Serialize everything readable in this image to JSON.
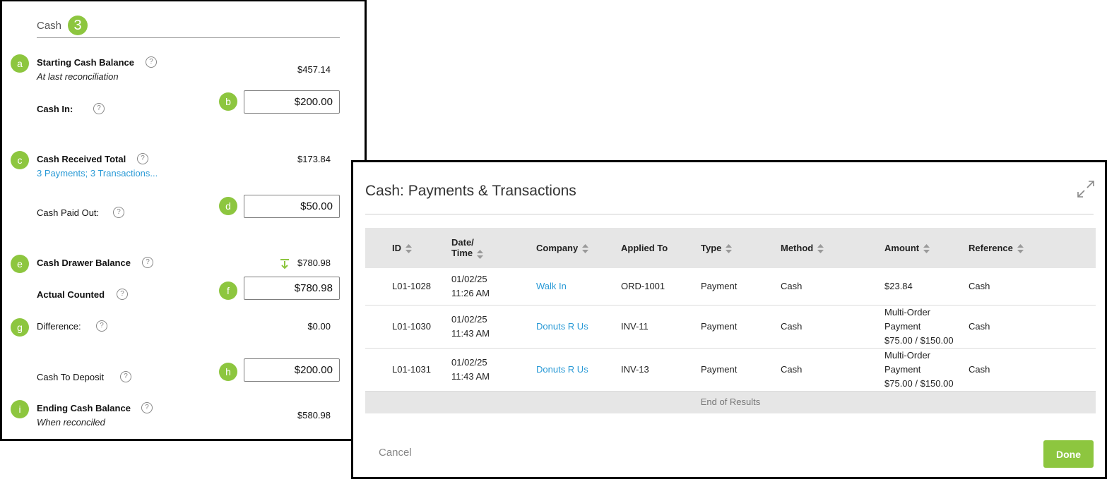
{
  "cash_panel": {
    "title": "Cash",
    "badge": "3",
    "starting": {
      "badge": "a",
      "label": "Starting Cash Balance",
      "sub": "At last reconciliation",
      "value": "$457.14"
    },
    "cash_in": {
      "label": "Cash In:",
      "badge": "b",
      "value": "$200.00"
    },
    "received": {
      "badge": "c",
      "label": "Cash Received Total",
      "link": "3 Payments; 3 Transactions...",
      "value": "$173.84"
    },
    "paid_out": {
      "label": "Cash Paid Out:",
      "badge": "d",
      "value": "$50.00"
    },
    "drawer": {
      "badge": "e",
      "label": "Cash Drawer Balance",
      "value": "$780.98"
    },
    "counted": {
      "label": "Actual Counted",
      "badge": "f",
      "value": "$780.98"
    },
    "difference": {
      "badge": "g",
      "label": "Difference:",
      "value": "$0.00"
    },
    "deposit": {
      "label": "Cash To Deposit",
      "badge": "h",
      "value": "$200.00"
    },
    "ending": {
      "badge": "i",
      "label": "Ending Cash Balance",
      "sub": "When reconciled",
      "value": "$580.98"
    },
    "help_glyph": "?"
  },
  "modal": {
    "title": "Cash: Payments & Transactions",
    "columns": {
      "id": "ID",
      "date_line1": "Date/",
      "date_line2": "Time",
      "company": "Company",
      "applied": "Applied To",
      "type": "Type",
      "method": "Method",
      "amount": "Amount",
      "reference": "Reference"
    },
    "rows": [
      {
        "id": "L01-1028",
        "date": "01/02/25",
        "time": "11:26 AM",
        "company": "Walk In",
        "applied": "ORD-1001",
        "type": "Payment",
        "method": "Cash",
        "amount1": "$23.84",
        "amount2": "",
        "amount3": "",
        "reference": "Cash"
      },
      {
        "id": "L01-1030",
        "date": "01/02/25",
        "time": "11:43 AM",
        "company": "Donuts R Us",
        "applied": "INV-11",
        "type": "Payment",
        "method": "Cash",
        "amount1": "Multi-Order",
        "amount2": "Payment",
        "amount3": "$75.00 / $150.00",
        "reference": "Cash"
      },
      {
        "id": "L01-1031",
        "date": "01/02/25",
        "time": "11:43 AM",
        "company": "Donuts R Us",
        "applied": "INV-13",
        "type": "Payment",
        "method": "Cash",
        "amount1": "Multi-Order",
        "amount2": "Payment",
        "amount3": "$75.00 / $150.00",
        "reference": "Cash"
      }
    ],
    "end_text": "End of Results",
    "cancel_label": "Cancel",
    "done_label": "Done"
  },
  "colors": {
    "accent": "#8dc63f",
    "link": "#2a9ad6",
    "header_bg": "#e6e6e6"
  },
  "icons": [
    "help-icon",
    "sort-icon",
    "expand-icon",
    "arrow-down-icon"
  ]
}
